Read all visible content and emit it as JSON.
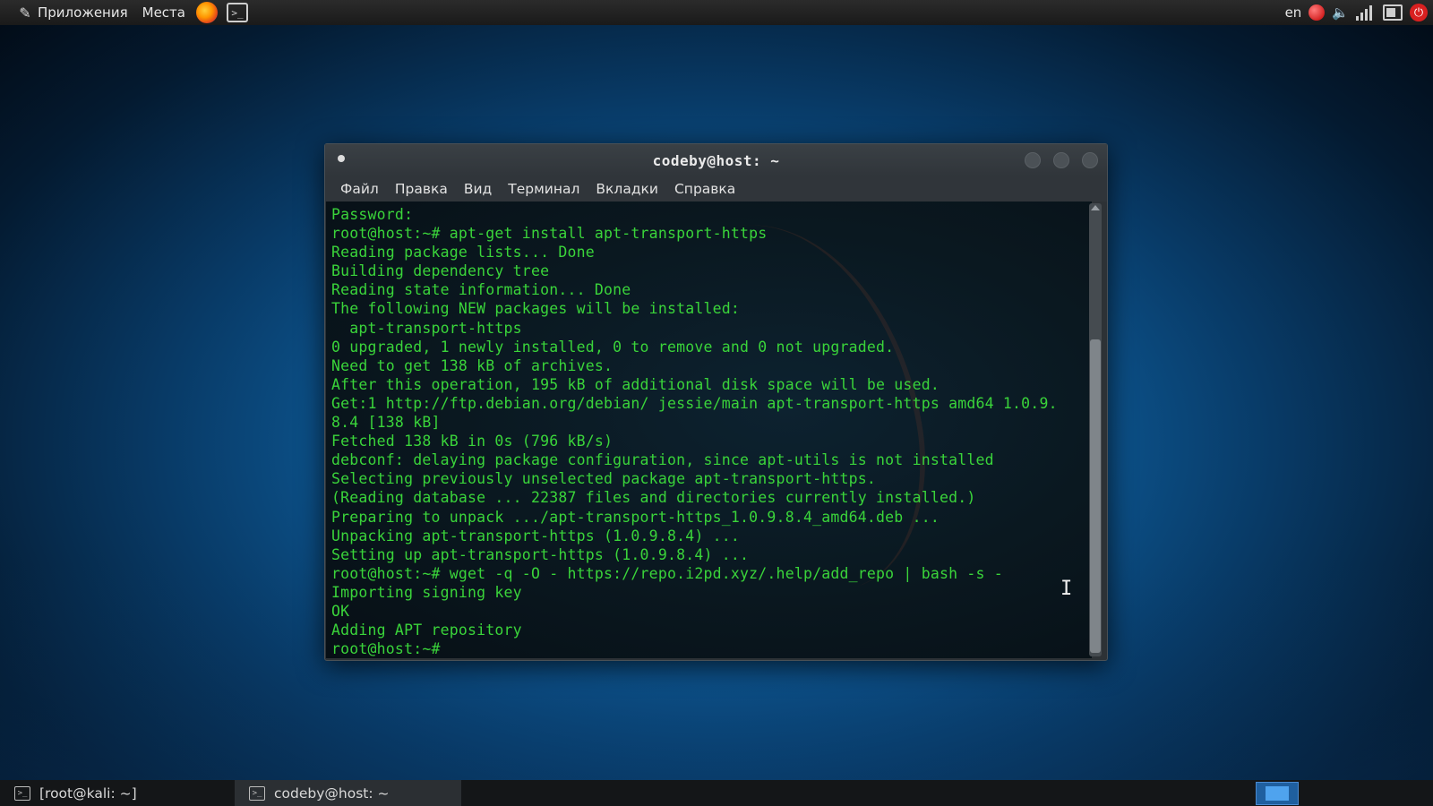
{
  "top_panel": {
    "applications_label": "Приложения",
    "places_label": "Места",
    "terminal_launcher_glyph": ">_",
    "language": "en",
    "icons": [
      "kali-dragon-icon",
      "firefox-icon",
      "terminal-icon",
      "record-icon",
      "volume-icon",
      "network-icon",
      "battery-icon",
      "power-icon"
    ]
  },
  "terminal_window": {
    "title": "codeby@host: ~",
    "menu": [
      "Файл",
      "Правка",
      "Вид",
      "Терминал",
      "Вкладки",
      "Справка"
    ],
    "text_color": "#3ad43a",
    "lines": [
      "Password:",
      "root@host:~# apt-get install apt-transport-https",
      "Reading package lists... Done",
      "Building dependency tree",
      "Reading state information... Done",
      "The following NEW packages will be installed:",
      "  apt-transport-https",
      "0 upgraded, 1 newly installed, 0 to remove and 0 not upgraded.",
      "Need to get 138 kB of archives.",
      "After this operation, 195 kB of additional disk space will be used.",
      "Get:1 http://ftp.debian.org/debian/ jessie/main apt-transport-https amd64 1.0.9.",
      "8.4 [138 kB]",
      "Fetched 138 kB in 0s (796 kB/s)",
      "debconf: delaying package configuration, since apt-utils is not installed",
      "Selecting previously unselected package apt-transport-https.",
      "(Reading database ... 22387 files and directories currently installed.)",
      "Preparing to unpack .../apt-transport-https_1.0.9.8.4_amd64.deb ...",
      "Unpacking apt-transport-https (1.0.9.8.4) ...",
      "Setting up apt-transport-https (1.0.9.8.4) ...",
      "root@host:~# wget -q -O - https://repo.i2pd.xyz/.help/add_repo | bash -s -",
      "Importing signing key",
      "OK",
      "Adding APT repository",
      "root@host:~#"
    ]
  },
  "taskbar": {
    "items": [
      {
        "label": "[root@kali: ~]"
      },
      {
        "label": "codeby@host: ~"
      }
    ]
  }
}
